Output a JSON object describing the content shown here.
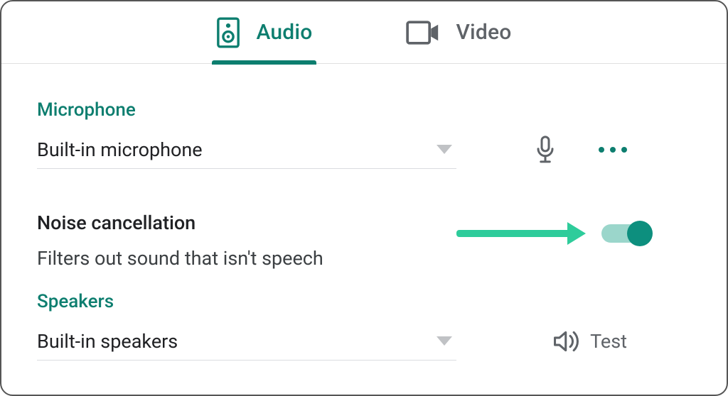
{
  "colors": {
    "accent": "#0d7e6f",
    "arrow": "#2ecc9b",
    "text": "#202124",
    "muted": "#5f6368"
  },
  "tabs": {
    "audio": {
      "label": "Audio",
      "active": true
    },
    "video": {
      "label": "Video",
      "active": false
    }
  },
  "microphone": {
    "section_label": "Microphone",
    "selected": "Built-in microphone"
  },
  "noise_cancellation": {
    "title": "Noise cancellation",
    "description": "Filters out sound that isn't speech",
    "enabled": true
  },
  "speakers": {
    "section_label": "Speakers",
    "selected": "Built-in speakers",
    "test_label": "Test"
  }
}
